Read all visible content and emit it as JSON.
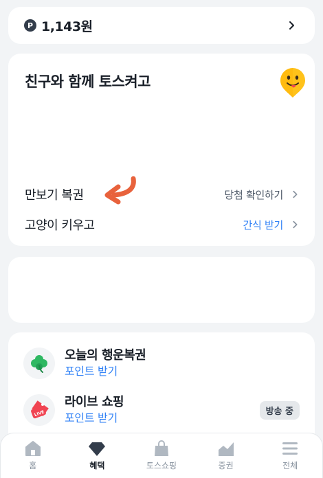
{
  "points": {
    "badge": "P",
    "value": "1,143원"
  },
  "friends_card": {
    "title": "친구와 함께 토스켜고",
    "rows": [
      {
        "label": "만보기 복권",
        "action": "당첨 확인하기",
        "action_color": "#4e5968"
      },
      {
        "label": "고양이 키우고",
        "action": "간식 받기",
        "action_color": "#3182f6"
      }
    ]
  },
  "rewards": [
    {
      "title": "오늘의 행운복권",
      "subtitle": "포인트 받기",
      "icon": "clover-icon"
    },
    {
      "title": "라이브 쇼핑",
      "subtitle": "포인트 받기",
      "icon": "live-tag-icon",
      "badge": "방송 중"
    }
  ],
  "nav": {
    "items": [
      {
        "label": "홈",
        "icon": "home-icon"
      },
      {
        "label": "혜택",
        "icon": "gem-icon",
        "active": true
      },
      {
        "label": "토스쇼핑",
        "icon": "shopping-bag-icon"
      },
      {
        "label": "증권",
        "icon": "stock-chart-icon"
      },
      {
        "label": "전체",
        "icon": "menu-icon"
      }
    ]
  },
  "colors": {
    "accent": "#3182f6",
    "arrow": "#e8623c",
    "background": "#f2f4f6"
  }
}
